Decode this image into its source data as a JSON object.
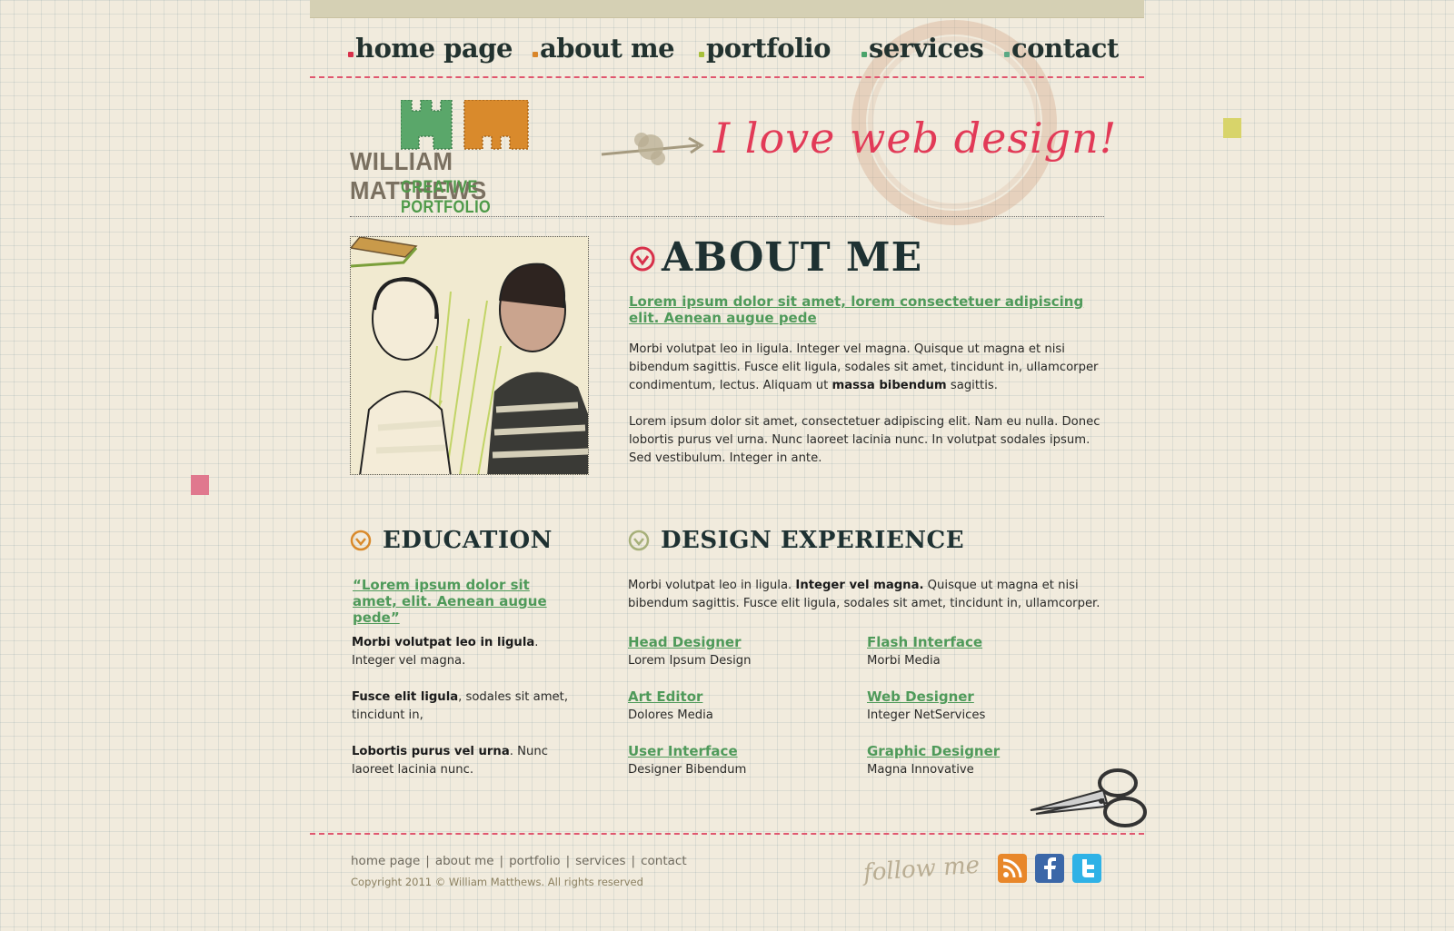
{
  "nav": {
    "items": [
      {
        "label": "home page",
        "dot": "#d8304a"
      },
      {
        "label": "about me",
        "dot": "#d9862a"
      },
      {
        "label": "portfolio",
        "dot": "#a7c03a"
      },
      {
        "label": "services",
        "dot": "#4aa36a"
      },
      {
        "label": "contact",
        "dot": "#5aa884"
      }
    ]
  },
  "logo": {
    "name": "WILLIAM MATTHEWS",
    "subtitle": "CREATIVE PORTFOLIO",
    "colors": {
      "green": "#5aa76a",
      "orange": "#d98a2c"
    }
  },
  "tagline": "I love web design!",
  "about": {
    "heading": "ABOUT ME",
    "lead": "Lorem ipsum dolor sit amet, lorem consectetuer adipiscing elit. Aenean augue pede",
    "para1_a": "Morbi volutpat leo in ligula. Integer vel magna. Quisque ut magna et nisi bibendum sagittis. Fusce elit ligula, sodales sit amet, tincidunt in, ullamcorper condimentum, lectus. Aliquam ut ",
    "para1_b": "massa bibendum",
    "para1_c": " sagittis.",
    "para2": "Lorem ipsum dolor sit amet, consectetuer adipiscing elit. Nam eu nulla. Donec lobortis purus vel urna. Nunc laoreet lacinia nunc. In volutpat sodales ipsum. Sed vestibulum. Integer in ante."
  },
  "education": {
    "heading": "EDUCATION",
    "quote": "“Lorem ipsum dolor sit amet, elit. Aenean augue pede”",
    "items": [
      {
        "bold": "Morbi volutpat leo in ligula",
        "rest": ". Integer vel magna."
      },
      {
        "bold": "Fusce elit ligula",
        "rest": ", sodales sit amet, tincidunt in,"
      },
      {
        "bold": "Lobortis purus vel urna",
        "rest": ". Nunc laoreet lacinia nunc."
      }
    ]
  },
  "experience": {
    "heading": "DESIGN EXPERIENCE",
    "intro_a": "Morbi volutpat leo in ligula. ",
    "intro_b": "Integer vel magna.",
    "intro_c": " Quisque ut magna et nisi bibendum sagittis. Fusce elit ligula, sodales sit amet, tincidunt in, ullamcorper.",
    "jobs": [
      {
        "title": "Head Designer",
        "company": "Lorem Ipsum Design"
      },
      {
        "title": "Flash Interface",
        "company": "Morbi Media"
      },
      {
        "title": "Art Editor",
        "company": "Dolores Media"
      },
      {
        "title": "Web Designer",
        "company": "Integer NetServices"
      },
      {
        "title": "User Interface",
        "company": "Designer Bibendum"
      },
      {
        "title": "Graphic Designer",
        "company": "Magna Innovative"
      }
    ]
  },
  "footer": {
    "links": [
      "home page",
      "about me",
      "portfolio",
      "services",
      "contact"
    ],
    "separator": "|",
    "copyright": "Copyright 2011 © William Matthews. All rights reserved",
    "follow": "follow me",
    "social": [
      {
        "name": "rss-icon",
        "color": "#e8872a"
      },
      {
        "name": "facebook-icon",
        "color": "#3b67a8"
      },
      {
        "name": "twitter-icon",
        "color": "#2fb2e6"
      }
    ]
  }
}
